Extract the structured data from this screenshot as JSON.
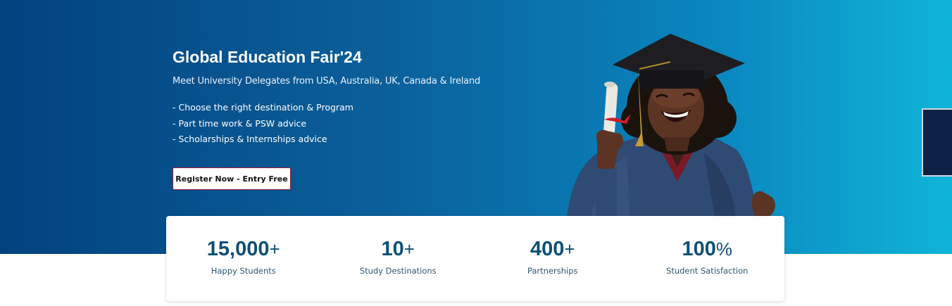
{
  "hero": {
    "title": "Global Education Fair'24",
    "subtitle": "Meet University Delegates from USA, Australia, UK, Canada & Ireland",
    "bullets": [
      "- Choose the right destination & Program",
      "- Part time work & PSW advice",
      "- Scholarships & Internships advice"
    ],
    "cta_label": "Register Now - Entry Free",
    "image_icon": "graduate-photo"
  },
  "stats": [
    {
      "value": "15,000",
      "suffix": "+",
      "label": "Happy Students"
    },
    {
      "value": "10",
      "suffix": "+",
      "label": "Study Destinations"
    },
    {
      "value": "400",
      "suffix": "+",
      "label": "Partnerships"
    },
    {
      "value": "100",
      "suffix": "%",
      "label": "Student Satisfaction"
    }
  ],
  "colors": {
    "hero_gradient_start": "#02427f",
    "hero_gradient_end": "#10b4d8",
    "stat_value": "#0e5076",
    "cta_border": "#9b1b2a",
    "side_tab": "#0d2246"
  }
}
